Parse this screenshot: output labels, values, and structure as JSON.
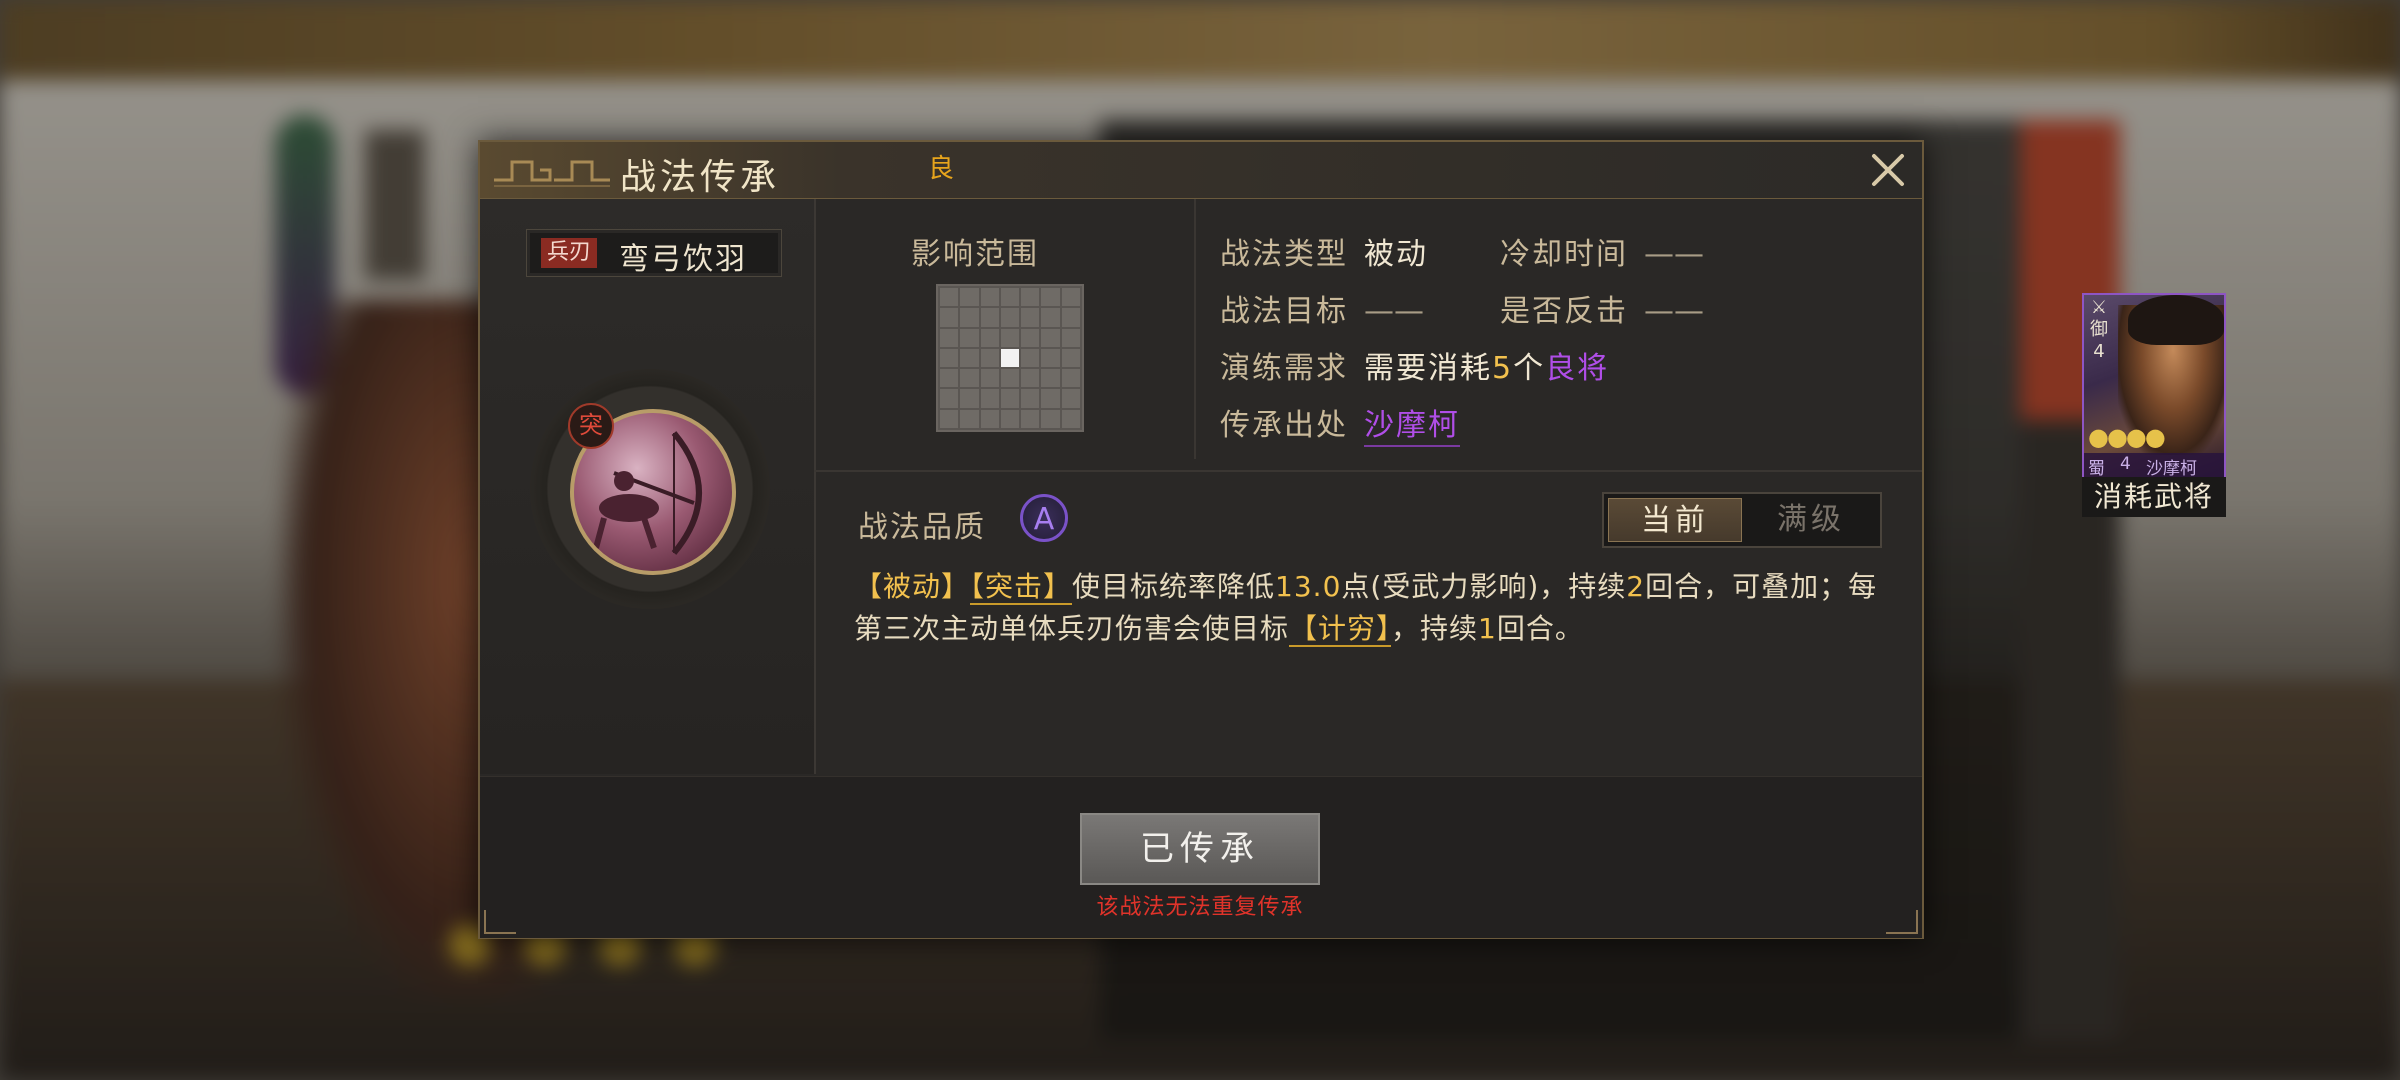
{
  "dialog": {
    "title": "战法传承",
    "title_badge": "良",
    "close_icon": "close-icon"
  },
  "skill": {
    "weapon_type": "兵刃",
    "name": "弯弓饮羽",
    "kind_badge": "突"
  },
  "range": {
    "label": "影响范围",
    "grid_cols": 7,
    "grid_rows": 7,
    "highlighted_cell": [
      3,
      3
    ]
  },
  "info": {
    "type_label": "战法类型",
    "type_value": "被动",
    "cooldown_label": "冷却时间",
    "cooldown_value": "——",
    "target_label": "战法目标",
    "target_value": "——",
    "counter_label": "是否反击",
    "counter_value": "——",
    "train_label": "演练需求",
    "train_prefix": "需要消耗",
    "train_count": "5",
    "train_mid": "个",
    "train_unit": "良将",
    "origin_label": "传承出处",
    "origin_value": "沙摩柯"
  },
  "hero_card": {
    "icon_top": "⚔",
    "icon_mid": "御",
    "icon_num": "4",
    "stars": "●●●●",
    "faction": "蜀",
    "cost": "4",
    "name": "沙摩柯",
    "caption": "消耗武将"
  },
  "quality": {
    "label": "战法品质",
    "grade": "A"
  },
  "toggle": {
    "current": "当前",
    "max": "满级"
  },
  "description": {
    "tag1": "【被动】",
    "tag2": "【突击】",
    "text1": "使目标统率降低",
    "num1": "13.0",
    "text2": "点(受武力影响)，持续",
    "num2": "2",
    "text3": "回合，可叠加；每第三次主动单体兵刃伤害会使目标",
    "tag3": "【计穷】",
    "text4": "，持续",
    "num3": "1",
    "text5": "回合。"
  },
  "footer": {
    "button_label": "已传承",
    "warning": "该战法无法重复传承"
  },
  "colors": {
    "accent_gold": "#f2c14e",
    "accent_purple": "#b04ee8",
    "warning_red": "#e0332a"
  }
}
